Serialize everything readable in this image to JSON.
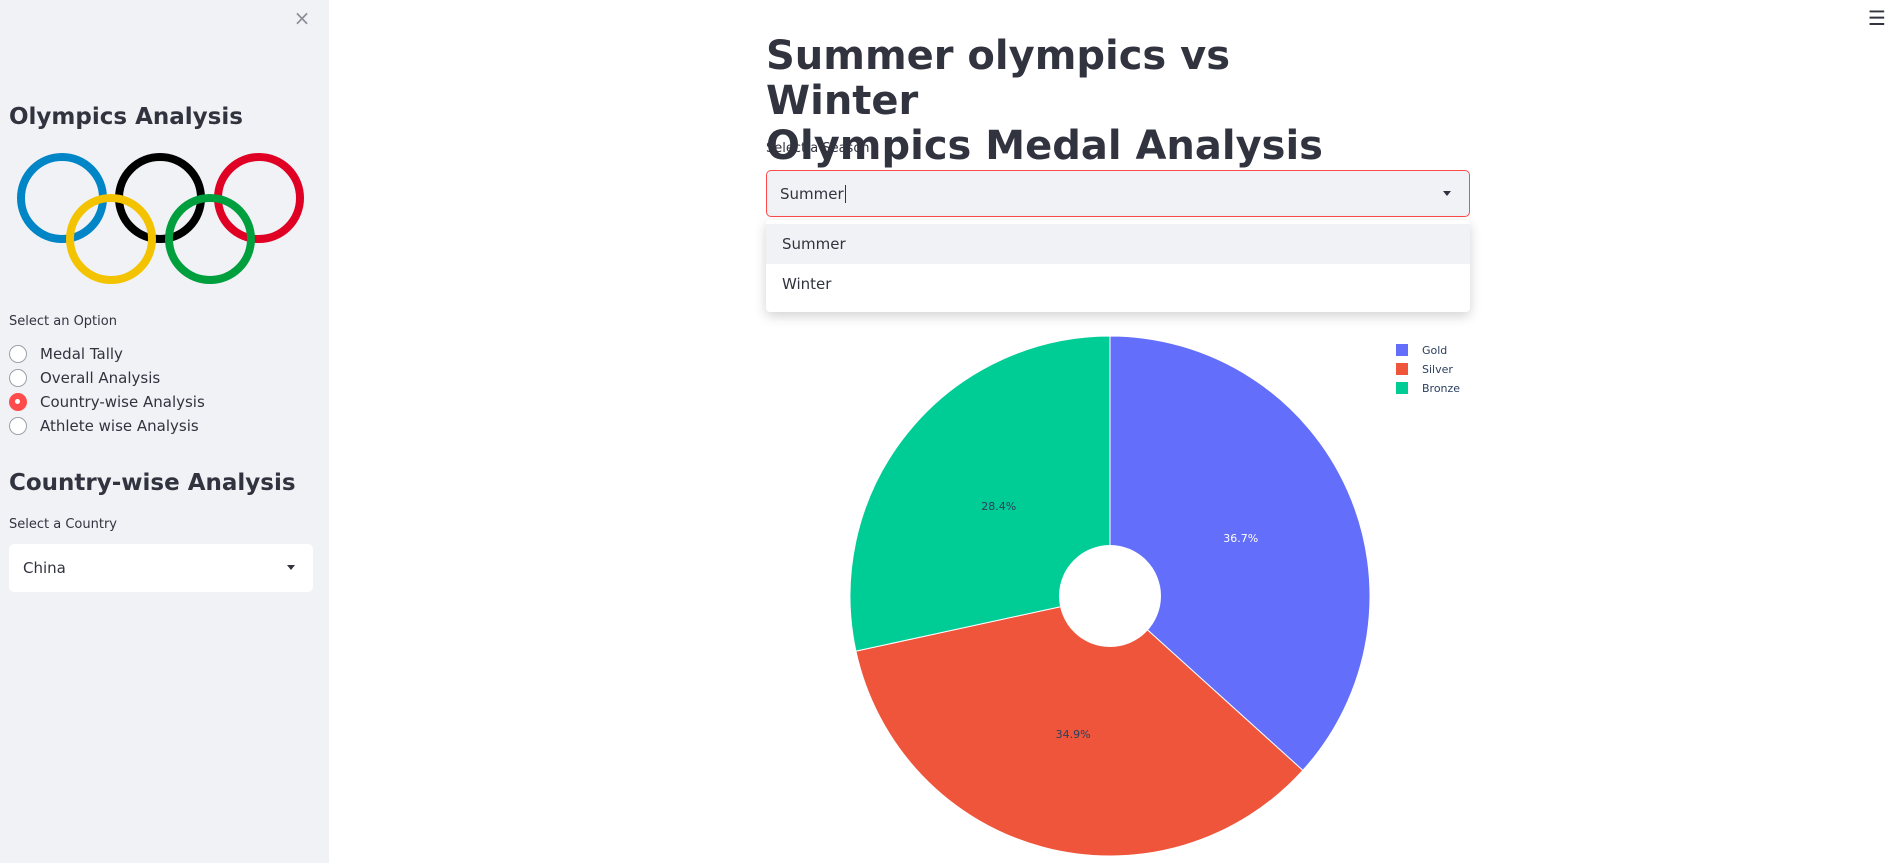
{
  "sidebar": {
    "close_icon": "×",
    "title": "Olympics Analysis",
    "logo": "olympic-rings",
    "option_label": "Select an Option",
    "options": [
      {
        "label": "Medal Tally",
        "selected": false
      },
      {
        "label": "Overall Analysis",
        "selected": false
      },
      {
        "label": "Country-wise Analysis",
        "selected": true
      },
      {
        "label": "Athlete wise Analysis",
        "selected": false
      }
    ],
    "subtitle": "Country-wise Analysis",
    "country_label": "Select a Country",
    "country_value": "China"
  },
  "header": {
    "menu_icon": "☰"
  },
  "main": {
    "title_line1": "Summer olympics vs Winter",
    "title_line2": "Olympics Medal Analysis",
    "season_label": "Select a Season",
    "season_value": "Summer",
    "season_options": [
      "Summer",
      "Winter"
    ]
  },
  "colors": {
    "accent": "#ff4b4b",
    "gold": "#636efa",
    "silver": "#ef553b",
    "bronze": "#00cc96"
  },
  "chart_data": {
    "type": "pie",
    "hole": true,
    "labels": [
      "Gold",
      "Silver",
      "Bronze"
    ],
    "values": [
      36.7,
      34.9,
      28.4
    ],
    "value_labels": [
      "36.7%",
      "34.9%",
      "28.4%"
    ],
    "colors": [
      "#636efa",
      "#ef553b",
      "#00cc96"
    ],
    "legend_position": "top-right"
  }
}
